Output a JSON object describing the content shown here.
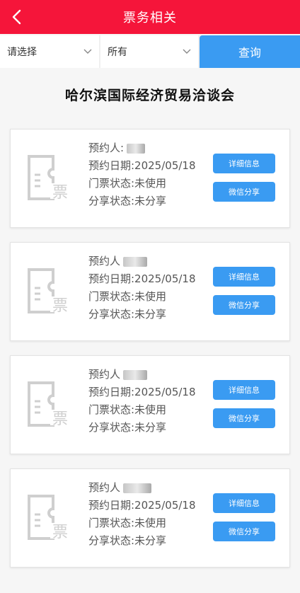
{
  "header": {
    "title": "票务相关"
  },
  "filters": {
    "select1": "请选择",
    "select2": "所有",
    "query_label": "查询"
  },
  "fair_title": "哈尔滨国际经济贸易洽谈会",
  "cards": [
    {
      "reserver_label": "预约人:",
      "date_text": "预约日期:2025/05/18",
      "ticket_status": "门票状态:未使用",
      "share_status": "分享状态:未分享",
      "detail_label": "详细信息",
      "share_label": "微信分享"
    },
    {
      "reserver_label": "预约人",
      "date_text": "预约日期:2025/05/18",
      "ticket_status": "门票状态:未使用",
      "share_status": "分享状态:未分享",
      "detail_label": "详细信息",
      "share_label": "微信分享"
    },
    {
      "reserver_label": "预约人",
      "date_text": "预约日期:2025/05/18",
      "ticket_status": "门票状态:未使用",
      "share_status": "分享状态:未分享",
      "detail_label": "详细信息",
      "share_label": "微信分享"
    },
    {
      "reserver_label": "预约人",
      "date_text": "预约日期:2025/05/18",
      "ticket_status": "门票状态:未使用",
      "share_status": "分享状态:未分享",
      "detail_label": "详细信息",
      "share_label": "微信分享"
    }
  ],
  "icons": {
    "back": "back-arrow-icon",
    "dropdown": "chevron-down-icon",
    "ticket": "ticket-icon"
  },
  "colors": {
    "header": "#f5153a",
    "button": "#3a9bf2"
  }
}
